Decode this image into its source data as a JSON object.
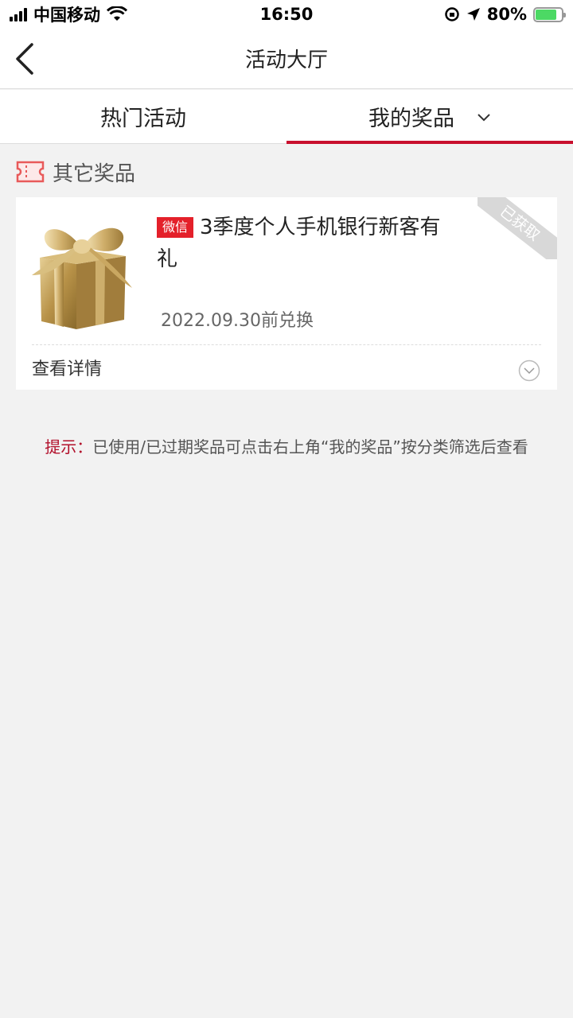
{
  "status_bar": {
    "carrier": "中国移动",
    "time": "16:50",
    "battery": "80%"
  },
  "nav": {
    "title": "活动大厅"
  },
  "tabs": [
    {
      "label": "热门活动",
      "active": false
    },
    {
      "label": "我的奖品",
      "active": true
    }
  ],
  "section": {
    "title": "其它奖品"
  },
  "prize": {
    "tag": "微信",
    "title": "3季度个人手机银行新客有礼",
    "expire": "2022.09.30前兑换",
    "status_ribbon": "已获取",
    "details_label": "查看详情"
  },
  "tip": {
    "label": "提示：",
    "text": "已使用/已过期奖品可点击右上角“我的奖品”按分类筛选后查看"
  },
  "colors": {
    "accent": "#c8102e",
    "tag_red": "#e4202a",
    "background": "#f2f2f2"
  }
}
